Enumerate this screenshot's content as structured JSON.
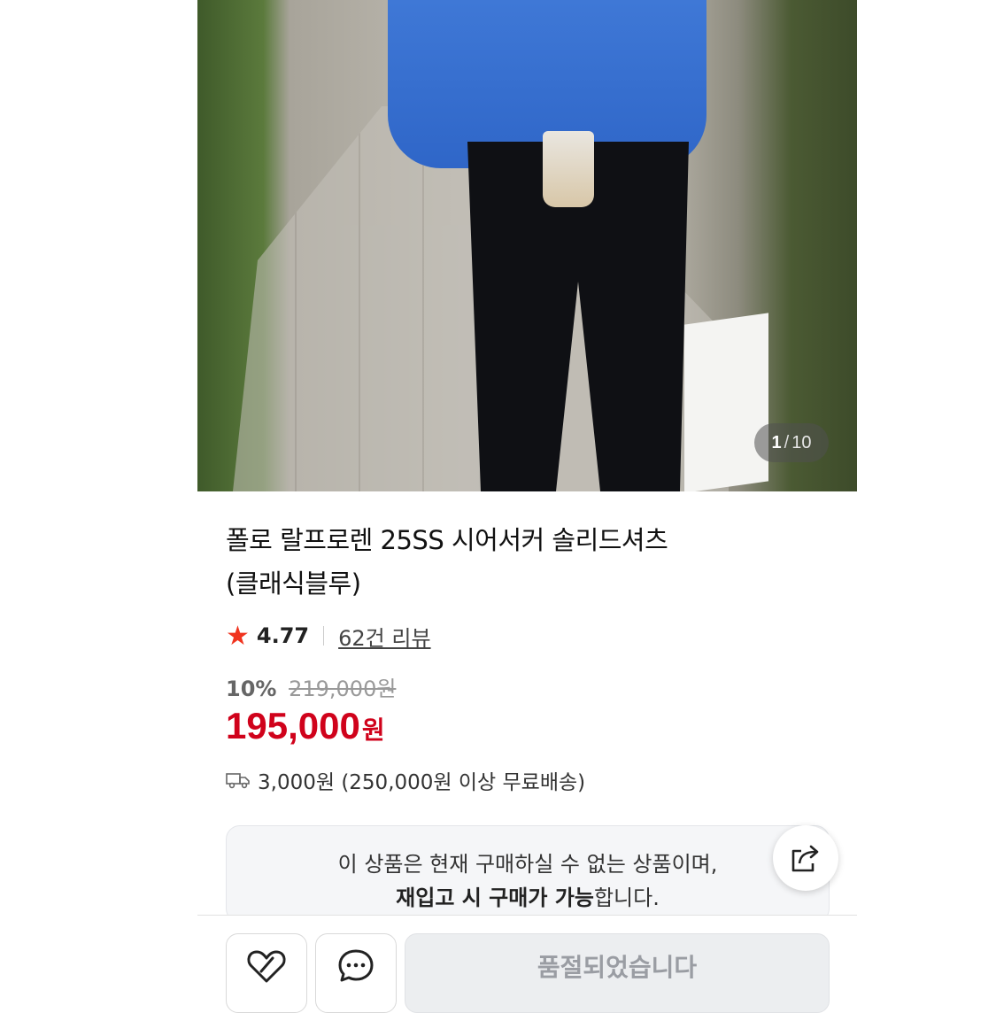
{
  "gallery": {
    "current": "1",
    "separator": "/",
    "total": "10"
  },
  "product": {
    "title_line1": "폴로 랄프로렌 25SS 시어서커 솔리드셔츠",
    "title_line2": "(클래식블루)",
    "rating": "4.77",
    "reviews_label": "62건 리뷰",
    "discount_percent": "10%",
    "original_price": "219,000원",
    "price": "195,000",
    "currency": "원",
    "shipping": "3,000원 (250,000원 이상 무료배송)"
  },
  "notice": {
    "line1": "이 상품은 현재 구매하실 수 없는 상품이며,",
    "line2_bold": "재입고 시 구매가 가능",
    "line2_rest": "합니다."
  },
  "actions": {
    "soldout_label": "품절되었습니다"
  },
  "colors": {
    "price_red": "#d0021b",
    "star_red": "#f0341f"
  },
  "icons": [
    "star-icon",
    "truck-icon",
    "share-icon",
    "heart-icon",
    "chat-icon"
  ]
}
